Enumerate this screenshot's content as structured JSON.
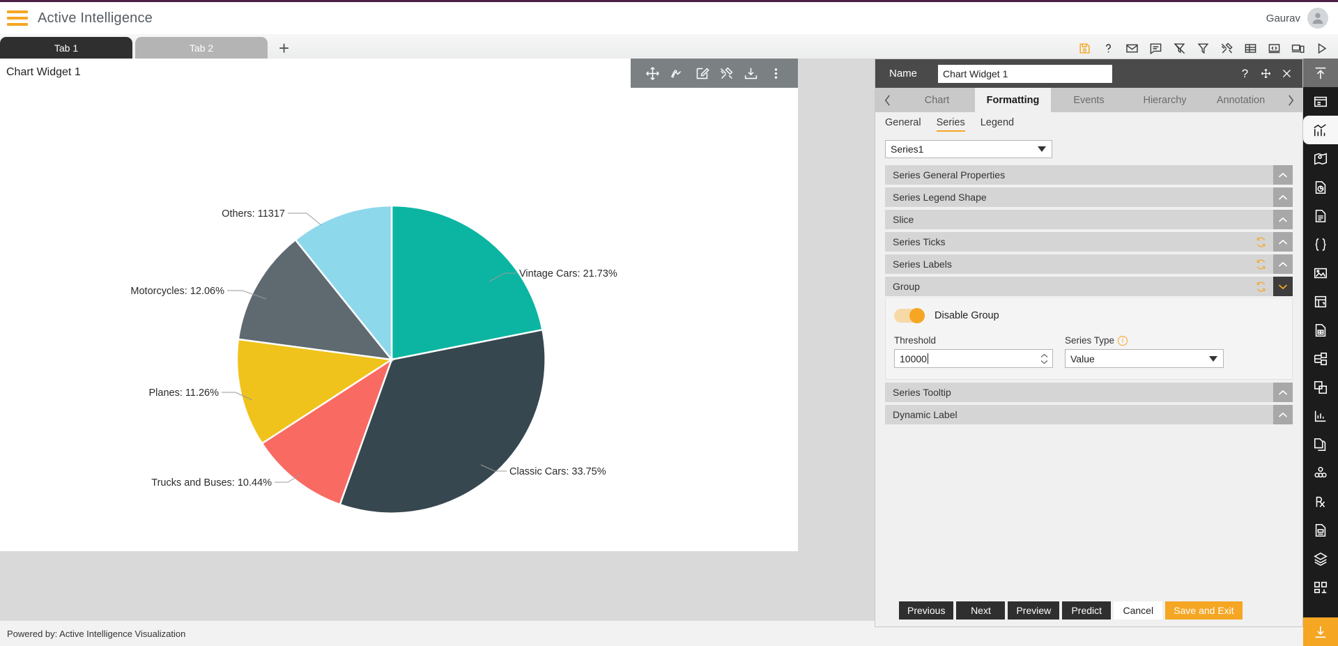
{
  "appbar": {
    "menu_icon": "hamburger-icon",
    "title": "Active Intelligence",
    "user_name": "Gaurav",
    "avatar_icon": "user-avatar-icon"
  },
  "tabs": {
    "items": [
      {
        "label": "Tab 1",
        "active": true
      },
      {
        "label": "Tab 2",
        "active": false
      }
    ],
    "add_label": "+",
    "toolbar_icons": [
      "save-icon",
      "help-icon",
      "mail-icon",
      "comment-icon",
      "filter-off-icon",
      "filter-icon",
      "tools-icon",
      "table-icon",
      "code-icon",
      "device-icon",
      "play-icon"
    ]
  },
  "widget": {
    "title": "Chart Widget 1",
    "toolbar_icons": [
      "move-icon",
      "scribble-icon",
      "edit-icon",
      "tools-icon",
      "download-icon",
      "more-vertical-icon"
    ]
  },
  "chart_data": {
    "type": "pie",
    "title": "",
    "legend_position": "none",
    "label_format": "outside-with-leader-lines",
    "categories": [
      "Vintage Cars",
      "Classic Cars",
      "Trucks and Buses",
      "Planes",
      "Motorcycles",
      "Others"
    ],
    "values": [
      21.73,
      33.75,
      10.44,
      11.26,
      12.06,
      10.76
    ],
    "labels": [
      "Vintage Cars: 21.73%",
      "Classic Cars: 33.75%",
      "Trucks and Buses: 10.44%",
      "Planes: 11.26%",
      "Motorcycles: 12.06%",
      "Others: 11317"
    ],
    "colors": [
      "#0bb5a2",
      "#37474f",
      "#f96a63",
      "#efc31b",
      "#5e6a70",
      "#8ed8ec"
    ],
    "start_angle_deg": 0,
    "direction": "clockwise",
    "others_raw_value": 11317
  },
  "status": {
    "text": "Powered by: Active Intelligence Visualization"
  },
  "panel": {
    "name_label": "Name",
    "name_value": "Chart Widget 1",
    "header_icons": [
      "help-icon",
      "move-icon",
      "close-icon"
    ],
    "prev_arrow": "chevron-left-icon",
    "next_arrow": "chevron-right-icon",
    "tabs": [
      {
        "label": "Chart",
        "active": false
      },
      {
        "label": "Formatting",
        "active": true
      },
      {
        "label": "Events",
        "active": false
      },
      {
        "label": "Hierarchy",
        "active": false
      },
      {
        "label": "Annotation",
        "active": false
      }
    ],
    "subtabs": [
      {
        "label": "General",
        "active": false
      },
      {
        "label": "Series",
        "active": true
      },
      {
        "label": "Legend",
        "active": false
      }
    ],
    "series_select": {
      "value": "Series1"
    },
    "accordions": [
      {
        "title": "Series General Properties",
        "refresh": false,
        "open": false
      },
      {
        "title": "Series Legend Shape",
        "refresh": false,
        "open": false
      },
      {
        "title": "Slice",
        "refresh": false,
        "open": false
      },
      {
        "title": "Series Ticks",
        "refresh": true,
        "open": false
      },
      {
        "title": "Series Labels",
        "refresh": true,
        "open": false
      },
      {
        "title": "Group",
        "refresh": true,
        "open": true
      }
    ],
    "group": {
      "toggle_label": "Disable Group",
      "toggle_on": true,
      "threshold_label": "Threshold",
      "threshold_value": "10000",
      "series_type_label": "Series Type",
      "series_type_value": "Value",
      "info_icon": "info-icon"
    },
    "accordions_after": [
      {
        "title": "Series Tooltip",
        "refresh": false,
        "open": false
      },
      {
        "title": "Dynamic Label",
        "refresh": false,
        "open": false
      }
    ],
    "buttons": [
      {
        "label": "Previous",
        "style": "dark"
      },
      {
        "label": "Next",
        "style": "dark"
      },
      {
        "label": "Preview",
        "style": "dark"
      },
      {
        "label": "Predict",
        "style": "dark"
      },
      {
        "label": "Cancel",
        "style": "light"
      },
      {
        "label": "Save and Exit",
        "style": "accent"
      }
    ]
  },
  "rail": {
    "items": [
      "collapse-up-icon",
      "dashboard-icon",
      "chart-icon",
      "map-icon",
      "report-pie-icon",
      "document-icon",
      "braces-icon",
      "image-icon",
      "widget-icon",
      "spreadsheet-icon",
      "flow-icon",
      "copy-icon",
      "sparkline-icon",
      "file-copy-icon",
      "cubes-icon",
      "prescription-icon",
      "file-script-icon",
      "layers-icon",
      "grid-icon",
      "download-icon"
    ]
  },
  "colors": {
    "accent": "#f5a623",
    "brand_bar": "#4b2045",
    "panel_dark": "#4a4a4a",
    "tab_active": "#2f2f2f"
  }
}
